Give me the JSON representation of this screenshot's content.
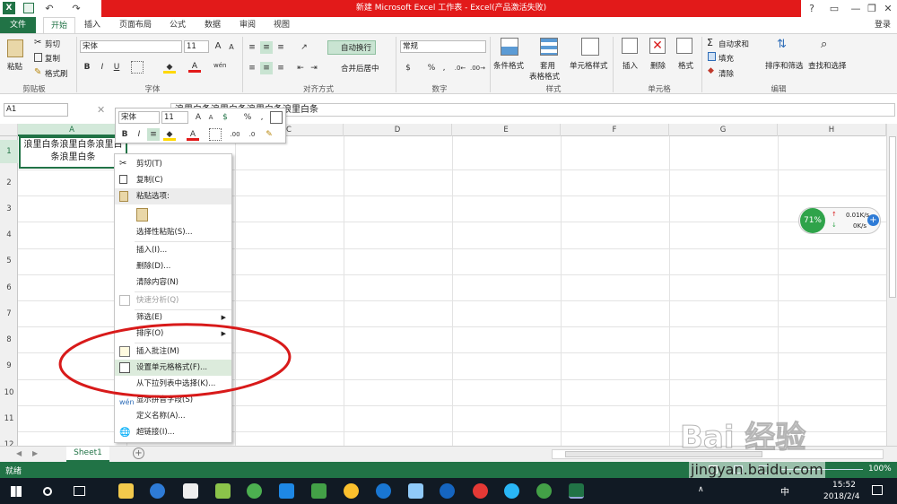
{
  "window": {
    "title": "新建 Microsoft Excel 工作表 - Excel(产品激活失败)",
    "help": "?",
    "minimize": "—",
    "restore": "❐",
    "close": "✕",
    "login": "登录",
    "qat_undo": "↶",
    "qat_redo": "↷"
  },
  "tabs": [
    "文件",
    "开始",
    "插入",
    "页面布局",
    "公式",
    "数据",
    "审阅",
    "视图"
  ],
  "ribbon": {
    "clipboard": {
      "label": "剪贴板",
      "paste": "粘贴",
      "cut": "剪切",
      "copy": "复制",
      "format_painter": "格式刷"
    },
    "font": {
      "label": "字体",
      "name": "宋体",
      "size": "11",
      "grow": "A",
      "shrink": "A",
      "bold": "B",
      "italic": "I",
      "underline": "U",
      "color_glyph": "A",
      "wen": "wén"
    },
    "alignment": {
      "label": "对齐方式",
      "wrap": "自动换行",
      "merge": "合并后居中"
    },
    "number": {
      "label": "数字",
      "format": "常规",
      "percent": "%",
      "comma": ","
    },
    "styles": {
      "label": "样式",
      "conditional": "条件格式",
      "table_format_1": "套用",
      "table_format_2": "表格格式",
      "cell_styles": "单元格样式"
    },
    "cells": {
      "label": "单元格",
      "insert": "插入",
      "delete": "删除",
      "format": "格式"
    },
    "editing": {
      "label": "编辑",
      "autosum": "自动求和",
      "fill": "填充",
      "clear": "清除",
      "sort_filter": "排序和筛选",
      "find_select": "查找和选择"
    }
  },
  "formula_bar": {
    "name_box": "A1",
    "content": "浪里白条浪里白条浪里白条浪里白条",
    "cancel": "✕",
    "enter": "✓",
    "fx": "fx"
  },
  "grid": {
    "columns": [
      "A",
      "B",
      "C",
      "D",
      "E",
      "F",
      "G",
      "H"
    ],
    "rows": [
      "1",
      "2",
      "3",
      "4",
      "5",
      "6",
      "7",
      "8",
      "9",
      "10",
      "11",
      "12"
    ],
    "a1_text": "浪里白条浪里白条浪里白条浪里白条"
  },
  "mini_toolbar": {
    "font": "宋体",
    "size": "11",
    "bold": "B",
    "italic": "I",
    "percent": "%",
    "comma": ",",
    "dec_inc": ".00",
    "dec_dec": ".0"
  },
  "context_menu": [
    {
      "label": "剪切(T)",
      "icon": "scissors-icon",
      "disabled": false
    },
    {
      "label": "复制(C)",
      "icon": "copy-icon",
      "disabled": false
    },
    {
      "label": "粘贴选项:",
      "icon": "paste-options-icon",
      "disabled": false
    },
    {
      "label": "",
      "icon": "paste-clipboard-icon",
      "disabled": false
    },
    {
      "label": "选择性粘贴(S)...",
      "icon": "",
      "disabled": false
    },
    {
      "label": "插入(I)...",
      "icon": "",
      "disabled": false
    },
    {
      "label": "删除(D)...",
      "icon": "",
      "disabled": false
    },
    {
      "label": "清除内容(N)",
      "icon": "",
      "disabled": false
    },
    {
      "label": "快速分析(Q)",
      "icon": "quick-analysis-icon",
      "disabled": true
    },
    {
      "label": "筛选(E)",
      "icon": "",
      "disabled": false
    },
    {
      "label": "排序(O)",
      "icon": "",
      "disabled": false
    },
    {
      "label": "插入批注(M)",
      "icon": "comment-icon",
      "disabled": false
    },
    {
      "label": "设置单元格格式(F)...",
      "icon": "format-cells-icon",
      "disabled": false
    },
    {
      "label": "从下拉列表中选择(K)...",
      "icon": "",
      "disabled": false
    },
    {
      "label": "显示拼音字段(S)",
      "icon": "phonetic-icon",
      "disabled": false
    },
    {
      "label": "定义名称(A)...",
      "icon": "",
      "disabled": false
    },
    {
      "label": "超链接(I)...",
      "icon": "hyperlink-icon",
      "disabled": false
    }
  ],
  "netspeed": {
    "percent": "71%",
    "up": "0.01K/s",
    "down": "0K/s"
  },
  "sheets": [
    "Sheet1"
  ],
  "status": {
    "ready": "就绪",
    "zoom": "100%"
  },
  "taskbar": {
    "time": "15:52",
    "date": "2018/2/4",
    "ime": "中"
  },
  "watermark": {
    "text": "jingyan.baidu.com",
    "logo": "Bai 经验"
  },
  "colors": {
    "excel_green": "#217346",
    "title_red": "#e21a1a",
    "annotation_red": "#d81a1a",
    "highlight": "#dcebdc"
  }
}
